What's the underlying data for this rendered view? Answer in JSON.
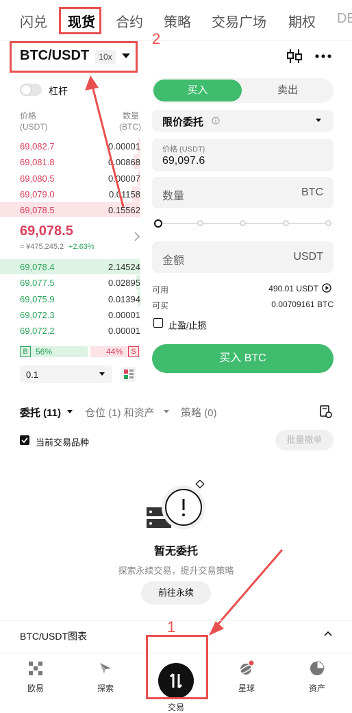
{
  "top_tabs": [
    "闪兑",
    "现货",
    "合约",
    "策略",
    "交易广场",
    "期权",
    "DE"
  ],
  "annotations": {
    "label_1": "1",
    "label_2": "2"
  },
  "pair": {
    "symbol": "BTC/USDT",
    "leverage": "10x"
  },
  "margin_toggle_label": "杠杆",
  "orderbook": {
    "price_header": "价格",
    "price_unit": "(USDT)",
    "qty_header": "数量",
    "qty_unit": "(BTC)",
    "asks": [
      {
        "price": "69,082.7",
        "qty": "0.00001",
        "depth": 0.02
      },
      {
        "price": "69,081.8",
        "qty": "0.00868",
        "depth": 0.05
      },
      {
        "price": "69,080.5",
        "qty": "0.00007",
        "depth": 0.02
      },
      {
        "price": "69,079.0",
        "qty": "0.01158",
        "depth": 0.06
      },
      {
        "price": "69,078.5",
        "qty": "0.15562",
        "depth": 1.0
      }
    ],
    "last_price": "69,078.5",
    "last_price_sub": "≈ ¥475,245.2",
    "last_change": "+2.63%",
    "bids": [
      {
        "price": "69,078.4",
        "qty": "2.14524",
        "depth": 1.0
      },
      {
        "price": "69,077.5",
        "qty": "0.02895",
        "depth": 0.03
      },
      {
        "price": "69,075.9",
        "qty": "0.01394",
        "depth": 0.02
      },
      {
        "price": "69,072.3",
        "qty": "0.00001",
        "depth": 0.0
      },
      {
        "price": "69,072.2",
        "qty": "0.00001",
        "depth": 0.0
      }
    ],
    "buy_ratio_label": "B",
    "buy_ratio": "56%",
    "sell_ratio": "44%",
    "sell_ratio_label": "S",
    "buy_ratio_value": 0.56,
    "precision": "0.1"
  },
  "form": {
    "buy_tab": "买入",
    "sell_tab": "卖出",
    "order_type": "限价委托",
    "price_label": "价格 (USDT)",
    "price_value": "69,097.6",
    "qty_placeholder": "数量",
    "qty_unit": "BTC",
    "amount_placeholder": "金额",
    "amount_unit": "USDT",
    "available_label": "可用",
    "available_value": "490.01 USDT",
    "can_buy_label": "可买",
    "can_buy_value": "0.00709161 BTC",
    "tpsl_label": "止盈/止损",
    "submit_label": "买入 BTC"
  },
  "orders": {
    "tabs": [
      "委托 (11)",
      "仓位 (1) 和资产",
      "策略 (0)"
    ],
    "current_pair_only": "当前交易品种",
    "batch_cancel": "批量撤单",
    "empty_title": "暂无委托",
    "empty_sub": "探索永续交易，提升交易策略",
    "goto_button": "前往永续"
  },
  "chart_bar_label": "BTC/USDT图表",
  "bottom_nav": [
    "欧易",
    "探索",
    "交易",
    "星球",
    "资产"
  ],
  "colors": {
    "buy": "#3fbc6d",
    "sell": "#d8415a",
    "annotation": "#e8504f"
  }
}
